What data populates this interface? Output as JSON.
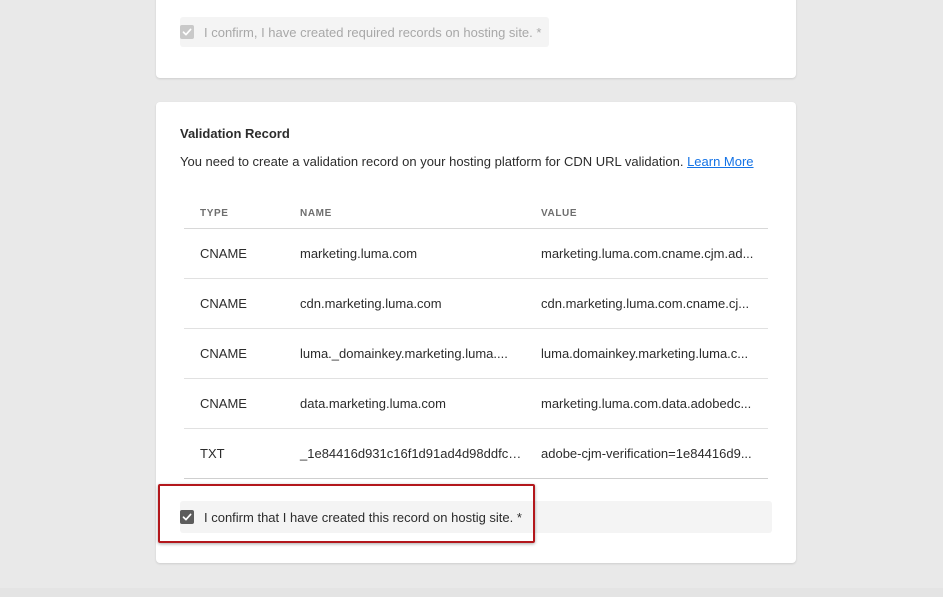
{
  "top_card": {
    "confirm_label": "I confirm, I have created required records on hosting site. *",
    "confirm_checked": true,
    "confirm_disabled": true
  },
  "validation": {
    "title": "Validation Record",
    "description": "You need to create a validation record on your hosting platform for CDN URL validation.",
    "learn_more": "Learn More",
    "columns": {
      "type": "TYPE",
      "name": "NAME",
      "value": "VALUE"
    },
    "rows": [
      {
        "type": "CNAME",
        "name": "marketing.luma.com",
        "value": "marketing.luma.com.cname.cjm.ad..."
      },
      {
        "type": "CNAME",
        "name": "cdn.marketing.luma.com",
        "value": "cdn.marketing.luma.com.cname.cj..."
      },
      {
        "type": "CNAME",
        "name": "luma._domainkey.marketing.luma....",
        "value": "luma.domainkey.marketing.luma.c..."
      },
      {
        "type": "CNAME",
        "name": "data.marketing.luma.com",
        "value": "marketing.luma.com.data.adobedc..."
      },
      {
        "type": "TXT",
        "name": "_1e84416d931c16f1d91ad4d98ddfcc...",
        "value": "adobe-cjm-verification=1e84416d9..."
      }
    ],
    "confirm_label": "I confirm that I have created this record on hostig site. *",
    "confirm_checked": true
  },
  "colors": {
    "link": "#1473e6",
    "highlight_border": "#b3171c",
    "checkbox_checked": "#5c5c5c",
    "checkbox_disabled": "#c9c9c9"
  }
}
